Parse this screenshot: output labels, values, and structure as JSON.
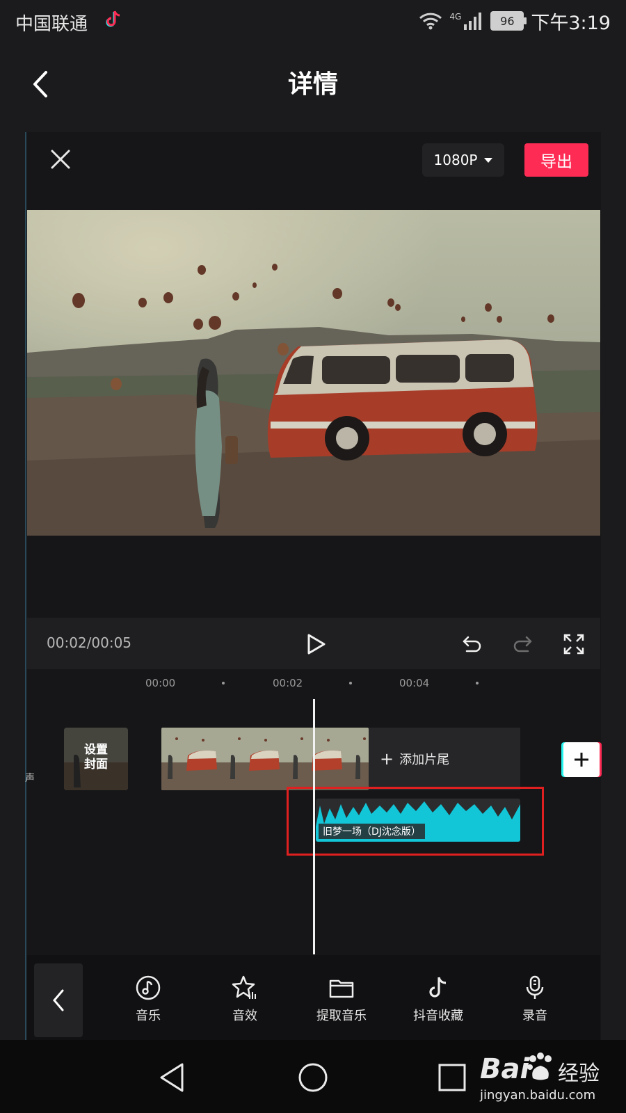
{
  "status_bar": {
    "carrier": "中国联通",
    "network": "4G",
    "battery": "96",
    "time": "下午3:19"
  },
  "header": {
    "title": "详情"
  },
  "editor": {
    "resolution": "1080P",
    "export_label": "导出",
    "timecode": "00:02/00:05",
    "ruler": [
      "00:00",
      "00:02",
      "00:04"
    ],
    "side_label": "声",
    "cover_label_line1": "设置",
    "cover_label_line2": "封面",
    "add_tail_label": "添加片尾",
    "audio_track_title": "旧梦一场（DJ沈念版）"
  },
  "tools": [
    {
      "label": "音乐",
      "icon": "music-note-icon"
    },
    {
      "label": "音效",
      "icon": "star-sound-icon"
    },
    {
      "label": "提取音乐",
      "icon": "folder-icon"
    },
    {
      "label": "抖音收藏",
      "icon": "tiktok-icon"
    },
    {
      "label": "录音",
      "icon": "microphone-icon"
    }
  ],
  "watermark": {
    "brand": "Bai",
    "brand_suffix": "经验",
    "url": "jingyan.baidu.com"
  },
  "colors": {
    "accent": "#fe2c55",
    "audio_wave": "#12c6d8",
    "highlight": "#e02020"
  }
}
